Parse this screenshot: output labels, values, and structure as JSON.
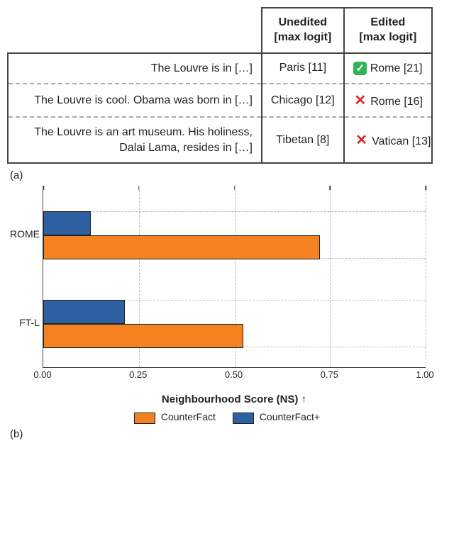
{
  "table": {
    "headers": {
      "unedited": "Unedited\n[max logit]",
      "edited": "Edited\n[max logit]"
    },
    "rows": [
      {
        "prompt": "The Louvre is in […]",
        "unedited": "Paris [11]",
        "edited": "Rome [21]",
        "edit_ok": true
      },
      {
        "prompt": "The Louvre is cool. Obama was born in […]",
        "unedited": "Chicago [12]",
        "edited": "Rome [16]",
        "edit_ok": false
      },
      {
        "prompt": "The Louvre is an art museum. His holiness, Dalai Lama, resides in […]",
        "unedited": "Tibetan [8]",
        "edited": "Vatican [13]",
        "edit_ok": false
      }
    ]
  },
  "label_a": "(a)",
  "label_b": "(b)",
  "chart_data": {
    "type": "bar",
    "orientation": "horizontal",
    "categories": [
      "ROME",
      "FT-L"
    ],
    "series": [
      {
        "name": "CounterFact+",
        "color": "#2f5fa3",
        "values": [
          0.12,
          0.21
        ]
      },
      {
        "name": "CounterFact",
        "color": "#f58220",
        "values": [
          0.72,
          0.52
        ]
      }
    ],
    "xlabel": "Neighbourhood Score (NS) ↑",
    "xlim": [
      0.0,
      1.0
    ],
    "xticks": [
      0.0,
      0.25,
      0.5,
      0.75,
      1.0
    ],
    "xtick_labels": [
      "0.00",
      "0.25",
      "0.50",
      "0.75",
      "1.00"
    ]
  },
  "legend": {
    "cf": "CounterFact",
    "cfp": "CounterFact+"
  }
}
